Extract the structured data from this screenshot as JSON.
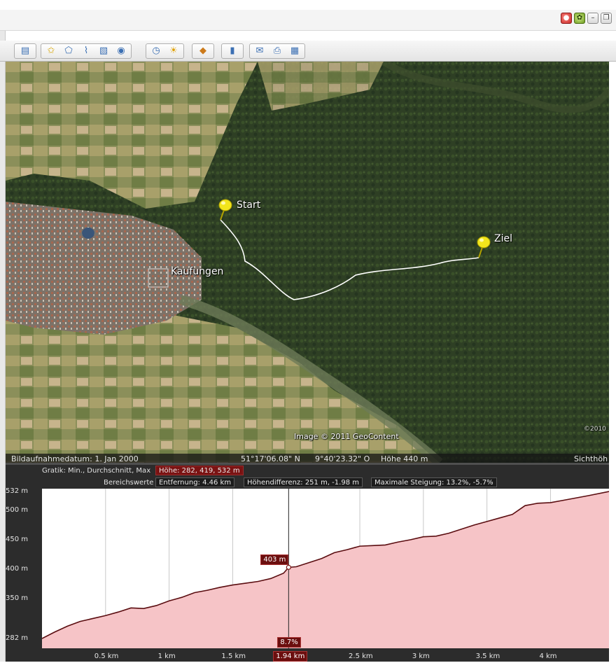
{
  "window": {
    "controls": [
      {
        "name": "notification-badge-icon",
        "glyph": "●"
      },
      {
        "name": "google-earth-leaf-icon",
        "glyph": "✿"
      },
      {
        "name": "minimize-button",
        "glyph": "–"
      },
      {
        "name": "restore-button",
        "glyph": "❐"
      }
    ]
  },
  "toolbar": {
    "buttons": [
      {
        "name": "sidebar-toggle-icon",
        "glyph": "▤",
        "color": "#3b6fb3"
      },
      {
        "name": "add-placemark-icon",
        "glyph": "✩",
        "color": "#d7a400"
      },
      {
        "name": "add-polygon-icon",
        "glyph": "⬠",
        "color": "#3b6fb3"
      },
      {
        "name": "add-path-icon",
        "glyph": "⌇",
        "color": "#3b6fb3"
      },
      {
        "name": "add-image-overlay-icon",
        "glyph": "▧",
        "color": "#3b6fb3"
      },
      {
        "name": "record-tour-icon",
        "glyph": "◉",
        "color": "#3b6fb3"
      },
      {
        "name": "historical-imagery-icon",
        "glyph": "◷",
        "color": "#3b6fb3"
      },
      {
        "name": "sunlight-icon",
        "glyph": "☀",
        "color": "#e0a000"
      },
      {
        "name": "switch-to-sky-icon",
        "glyph": "◆",
        "color": "#cc7a1a"
      },
      {
        "name": "ruler-icon",
        "glyph": "▮",
        "color": "#3b6fb3"
      },
      {
        "name": "email-icon",
        "glyph": "✉",
        "color": "#3b6fb3"
      },
      {
        "name": "print-icon",
        "glyph": "⎙",
        "color": "#3b6fb3"
      },
      {
        "name": "view-in-maps-icon",
        "glyph": "▦",
        "color": "#3b6fb3"
      }
    ]
  },
  "map": {
    "placemarks": [
      {
        "name": "start",
        "label": "Start"
      },
      {
        "name": "ziel",
        "label": "Ziel"
      }
    ],
    "town_label": "Kaufungen",
    "copyright": "Image © 2011 GeoContent",
    "corner_text": "©2010"
  },
  "statusbar": {
    "imagery_date": "Bildaufnahmedatum:  1. Jan 2000",
    "latitude": "51°17'06.08\" N",
    "longitude": "9°40'23.32\" O",
    "altitude": "Höhe  440 m",
    "eye_alt": "Sichthöh"
  },
  "elevation_profile": {
    "graph_label": "Gratik: Min., Durchschnitt, Max",
    "height_box": "Höhe: 282, 419, 532 m",
    "range_label": "Bereichswerte",
    "distance_box": "Entfernung: 4.46 km",
    "height_diff_box": "Höhendifferenz: 251 m, -1.98 m",
    "max_slope_box": "Maximale Steigung: 13.2%, -5.7%",
    "cursor_elevation": "403 m",
    "cursor_slope": "8.7%",
    "cursor_distance": "1.94 km"
  },
  "chart_data": {
    "type": "area",
    "title": "",
    "xlabel": "",
    "ylabel": "",
    "xlim": [
      0,
      4.46
    ],
    "ylim": [
      282,
      532
    ],
    "x_tick_labels": [
      {
        "value": 0.5,
        "label": "0.5 km"
      },
      {
        "value": 1.0,
        "label": "1 km"
      },
      {
        "value": 1.5,
        "label": "1.5 km"
      },
      {
        "value": 2.5,
        "label": "2.5 km"
      },
      {
        "value": 3.0,
        "label": "3 km"
      },
      {
        "value": 3.5,
        "label": "3.5 km"
      },
      {
        "value": 4.0,
        "label": "4 km"
      }
    ],
    "y_tick_labels": [
      {
        "value": 532,
        "label": "532 m"
      },
      {
        "value": 500,
        "label": "500 m"
      },
      {
        "value": 450,
        "label": "450 m"
      },
      {
        "value": 400,
        "label": "400 m"
      },
      {
        "value": 350,
        "label": "350 m"
      },
      {
        "value": 282,
        "label": "282 m"
      }
    ],
    "grid": true,
    "cursor": {
      "x": 1.94,
      "y": 403
    },
    "colors": {
      "fill": "#f6c4c7",
      "line": "#5a0d10",
      "cursor": "#7a1313"
    },
    "series": [
      {
        "x": [
          0,
          0.1,
          0.2,
          0.3,
          0.4,
          0.5,
          0.6,
          0.7,
          0.8,
          0.9,
          1.0,
          1.1,
          1.2,
          1.3,
          1.4,
          1.5,
          1.6,
          1.7,
          1.8,
          1.9,
          1.94,
          2.0,
          2.1,
          2.2,
          2.3,
          2.4,
          2.5,
          2.6,
          2.7,
          2.8,
          2.9,
          3.0,
          3.1,
          3.2,
          3.3,
          3.4,
          3.5,
          3.6,
          3.7,
          3.8,
          3.9,
          4.0,
          4.1,
          4.2,
          4.3,
          4.46
        ],
        "y": [
          282,
          293,
          303,
          311,
          316,
          321,
          327,
          334,
          333,
          338,
          346,
          352,
          360,
          364,
          369,
          373,
          376,
          379,
          384,
          393,
          403,
          404,
          411,
          418,
          428,
          433,
          439,
          440,
          441,
          446,
          450,
          455,
          456,
          461,
          468,
          475,
          481,
          487,
          493,
          508,
          512,
          513,
          517,
          521,
          525,
          532
        ]
      }
    ]
  }
}
